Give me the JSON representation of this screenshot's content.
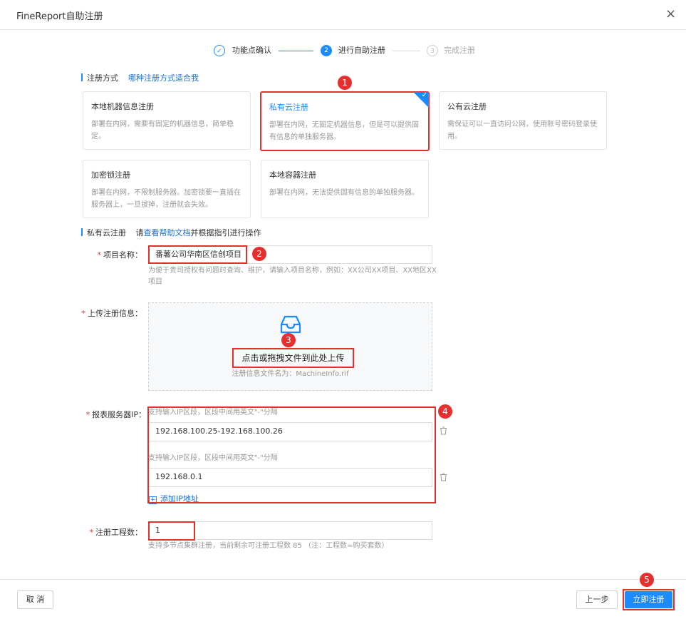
{
  "dialog": {
    "title": "FineReport自助注册",
    "close_glyph": "×"
  },
  "steps": [
    {
      "label": "功能点确认",
      "state": "done",
      "number": "✓"
    },
    {
      "label": "进行自助注册",
      "state": "active",
      "number": "2"
    },
    {
      "label": "完成注册",
      "state": "pending",
      "number": "3"
    }
  ],
  "method": {
    "title": "注册方式",
    "help_link": "哪种注册方式适合我"
  },
  "cards": [
    {
      "title": "本地机器信息注册",
      "desc": "部署在内网，需要有固定的机器信息，简单稳定。"
    },
    {
      "title": "私有云注册",
      "desc": "部署在内网，无固定机器信息，但是可以提供固有信息的单独服务器。"
    },
    {
      "title": "公有云注册",
      "desc": "需保证可以一直访问公网，使用账号密码登录使用。"
    },
    {
      "title": "加密锁注册",
      "desc": "部署在内网，不限制服务器。加密锁要一直插在服务器上，一旦拔掉，注册就会失效。"
    },
    {
      "title": "本地容器注册",
      "desc": "部署在内网，无法提供固有信息的单独服务器。"
    }
  ],
  "private_cloud": {
    "title": "私有云注册",
    "guide_prefix": "请",
    "guide_link": "查看帮助文档",
    "guide_suffix": "并根据指引进行操作"
  },
  "form": {
    "project_name": {
      "label": "项目名称：",
      "value": "番薯公司华南区信创项目",
      "hint": "为便于贵司授权有问题时查询、维护，请输入项目名称，例如：XX公司XX项目、XX地区XX项目"
    },
    "upload": {
      "label": "上传注册信息：",
      "text": "点击或拖拽文件到此处上传",
      "hint": "注册信息文件名为：MachineInfo.rif"
    },
    "server_ip": {
      "label": "报表服务器IP：",
      "entries": [
        {
          "hint": "支持输入IP区段，区段中间用英文\"-\"分隔",
          "value": "192.168.100.25-192.168.100.26"
        },
        {
          "hint": "支持输入IP区段，区段中间用英文\"-\"分隔",
          "value": "192.168.0.1"
        }
      ],
      "add_label": "添加IP地址"
    },
    "project_count": {
      "label": "注册工程数：",
      "value": "1",
      "hint": "支持多节点集群注册，当前剩余可注册工程数 85  （注：工程数=购买套数）"
    }
  },
  "annotations": [
    "1",
    "2",
    "3",
    "4",
    "5"
  ],
  "footer": {
    "cancel": "取 消",
    "prev": "上一步",
    "submit": "立即注册"
  },
  "colors": {
    "accent": "#1a8cff",
    "highlight": "#e63030"
  }
}
